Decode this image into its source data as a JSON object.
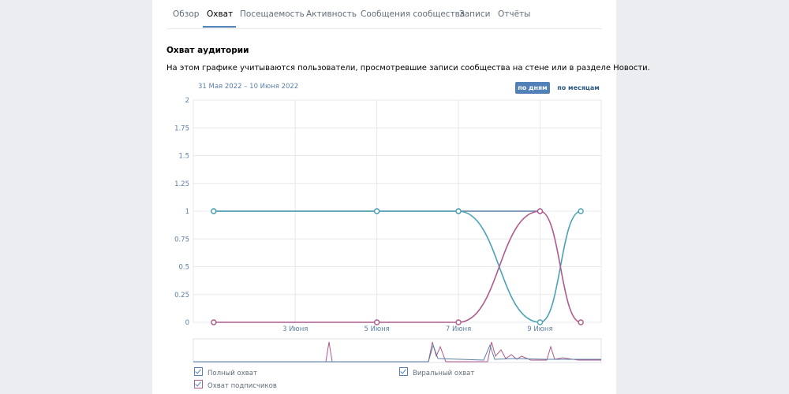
{
  "tabs": [
    {
      "label": "Обзор",
      "active": false
    },
    {
      "label": "Охват",
      "active": true
    },
    {
      "label": "Посещаемость",
      "active": false
    },
    {
      "label": "Активность",
      "active": false
    },
    {
      "label": "Сообщения сообщества",
      "active": false
    },
    {
      "label": "Записи",
      "active": false
    },
    {
      "label": "Отчёты",
      "active": false
    }
  ],
  "section": {
    "title": "Охват аудитории",
    "description": "На этом графике учитываются пользователи, просмотревшие записи сообщества на стене или в разделе Новости."
  },
  "chart_controls": {
    "range": "31 Мая 2022 – 10 Июня 2022",
    "by_days": "по дням",
    "by_months": "по месяцам"
  },
  "legend": {
    "full": "Полный охват",
    "viral": "Виральный охват",
    "subscribers": "Охват подписчиков"
  },
  "colors": {
    "accent": "#5181b8",
    "full": "#5b7fa6",
    "viral": "#4aa3b5",
    "subscribers": "#b05a8c",
    "grid": "#e7e8ec"
  },
  "chart_data": {
    "type": "line",
    "ylim": [
      0,
      2
    ],
    "yticks": [
      "0",
      "0.25",
      "0.5",
      "0.75",
      "1",
      "1.25",
      "1.5",
      "1.75",
      "2"
    ],
    "xticks": [
      "3 Июня",
      "5 Июня",
      "7 Июня",
      "9 Июня"
    ],
    "series": [
      {
        "name": "Полный охват",
        "points": [
          [
            1,
            1
          ],
          [
            5,
            1
          ],
          [
            7,
            1
          ],
          [
            9,
            1
          ]
        ]
      },
      {
        "name": "Виральный охват",
        "points": [
          [
            1,
            1
          ],
          [
            5,
            1
          ],
          [
            7,
            1
          ],
          [
            9,
            0
          ],
          [
            10,
            1
          ]
        ]
      },
      {
        "name": "Охват подписчиков",
        "points": [
          [
            1,
            0
          ],
          [
            5,
            0
          ],
          [
            7,
            0
          ],
          [
            9,
            1
          ],
          [
            10,
            0
          ]
        ]
      }
    ]
  }
}
